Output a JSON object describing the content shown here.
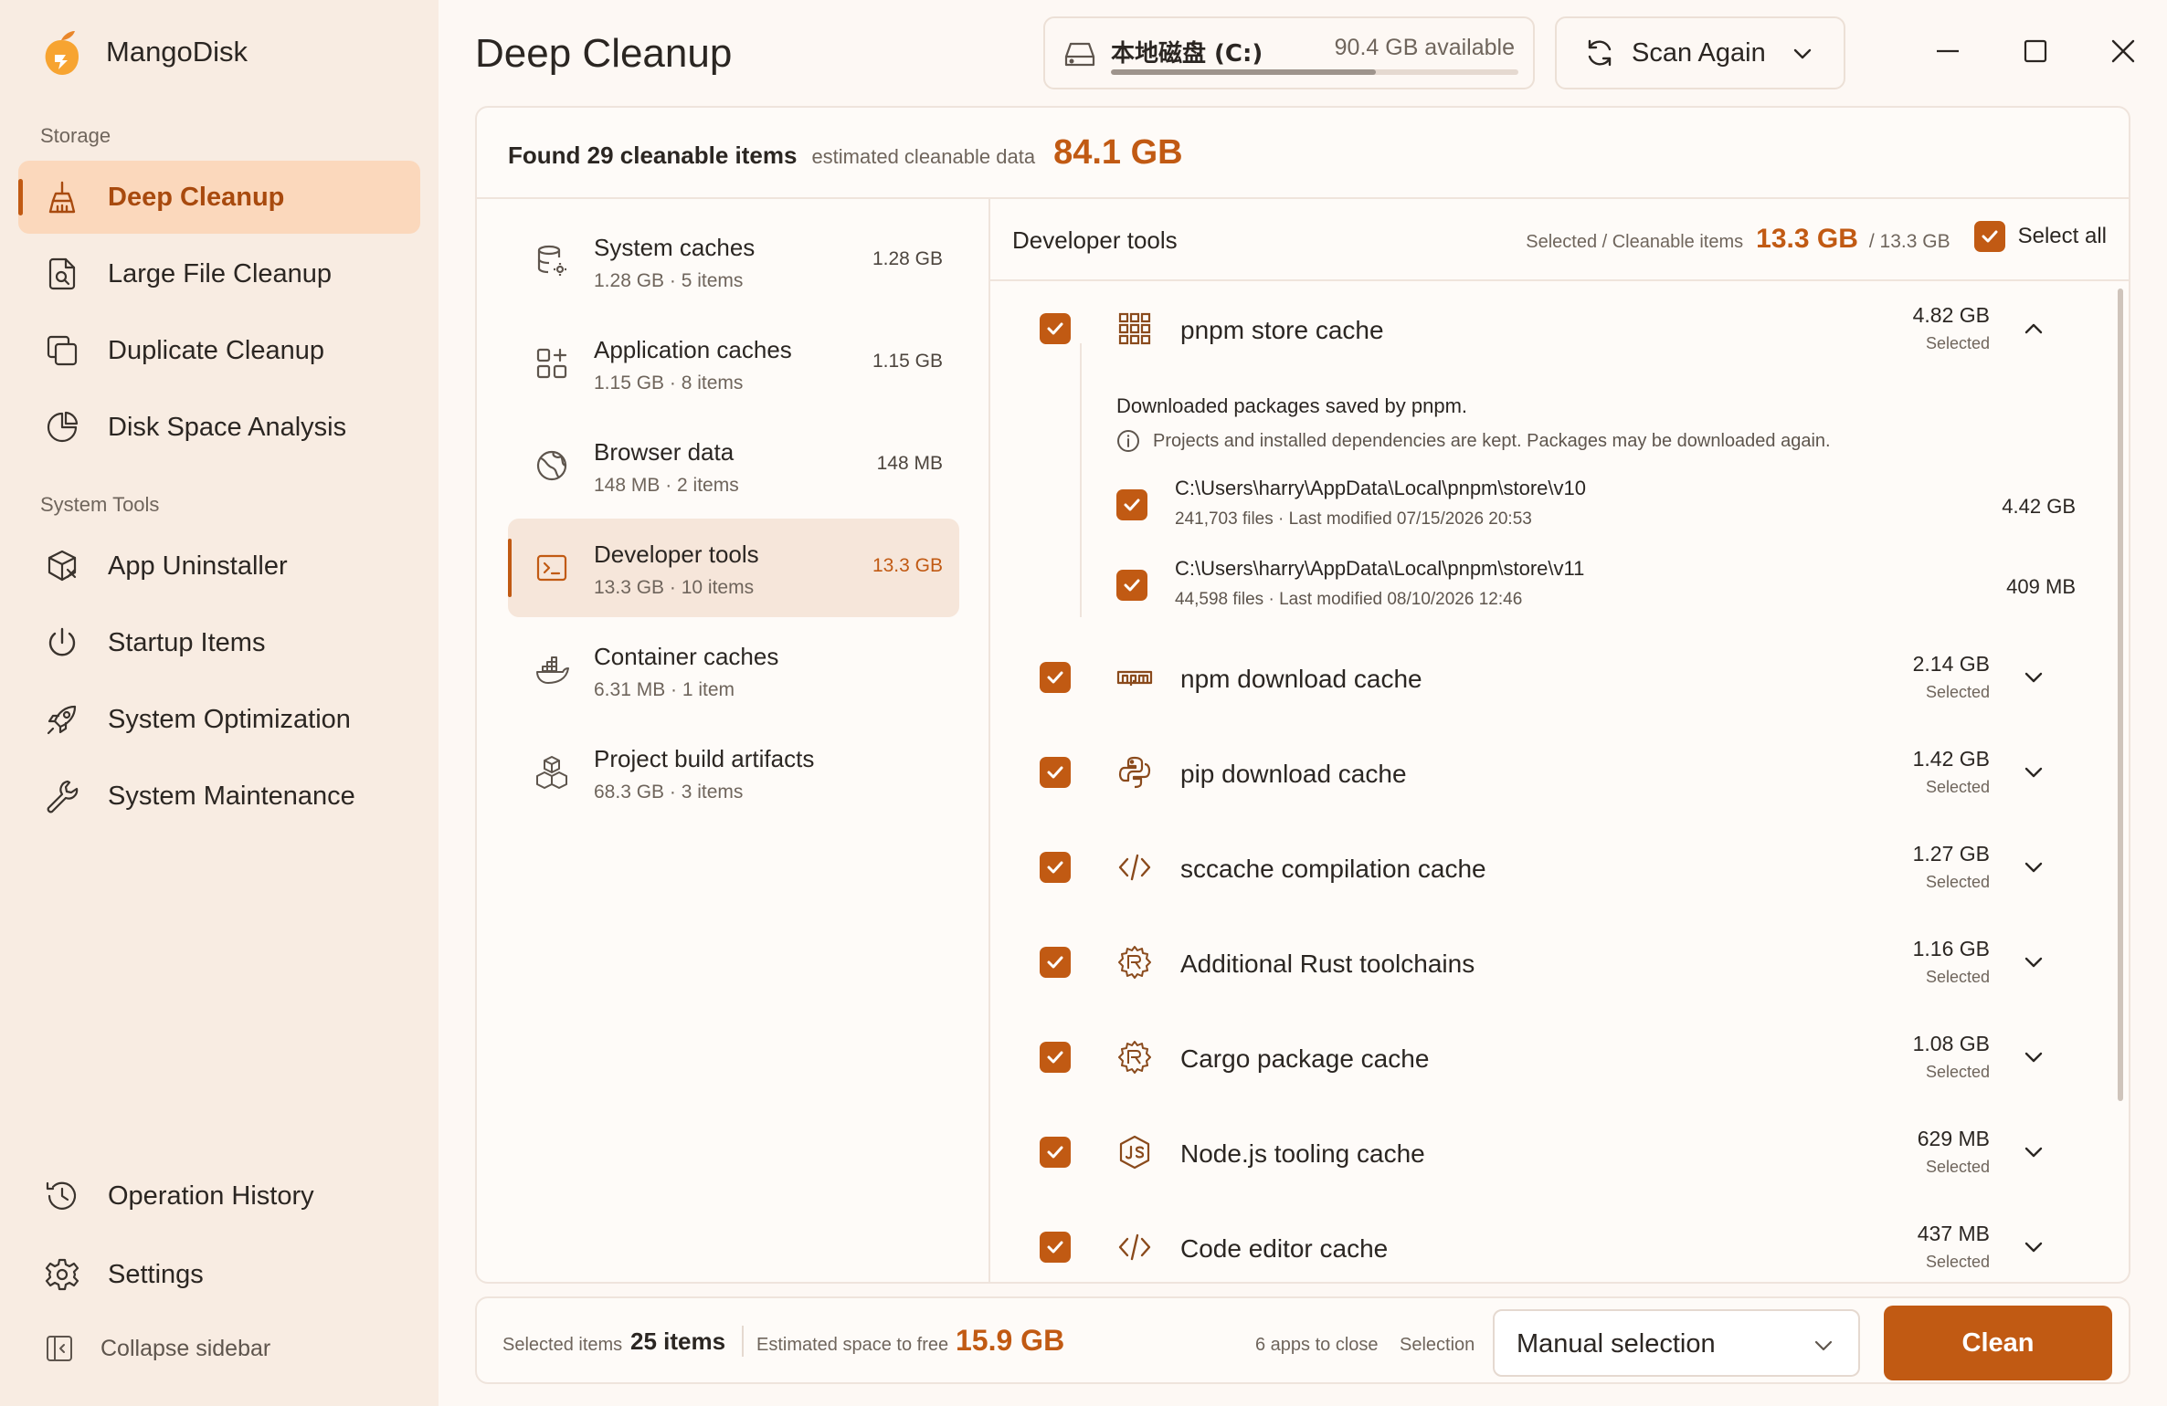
{
  "app": {
    "name": "MangoDisk"
  },
  "sidebar": {
    "sections": [
      {
        "label": "Storage"
      },
      {
        "label": "System Tools"
      }
    ],
    "items": [
      {
        "label": "Deep Cleanup",
        "icon": "broom-icon"
      },
      {
        "label": "Large File Cleanup",
        "icon": "file-search-icon"
      },
      {
        "label": "Duplicate Cleanup",
        "icon": "copy-icon"
      },
      {
        "label": "Disk Space Analysis",
        "icon": "pie-chart-icon"
      },
      {
        "label": "App Uninstaller",
        "icon": "package-x-icon"
      },
      {
        "label": "Startup Items",
        "icon": "power-icon"
      },
      {
        "label": "System Optimization",
        "icon": "rocket-icon"
      },
      {
        "label": "System Maintenance",
        "icon": "wrench-icon"
      },
      {
        "label": "Operation History",
        "icon": "history-icon"
      },
      {
        "label": "Settings",
        "icon": "gear-icon"
      }
    ],
    "collapse_label": "Collapse sidebar"
  },
  "header": {
    "title": "Deep Cleanup",
    "drive": {
      "name": "本地磁盘 (C:)",
      "available": "90.4 GB available",
      "used_fraction": 0.65
    },
    "scan_label": "Scan Again"
  },
  "summary": {
    "found": "Found 29 cleanable items",
    "estimated_label": "estimated cleanable data",
    "estimated_value": "84.1 GB"
  },
  "categories": [
    {
      "title": "System caches",
      "sub": "1.28 GB · 5 items",
      "size": "1.28 GB"
    },
    {
      "title": "Application caches",
      "sub": "1.15 GB · 8 items",
      "size": "1.15 GB"
    },
    {
      "title": "Browser data",
      "sub": "148 MB · 2 items",
      "size": "148 MB"
    },
    {
      "title": "Developer tools",
      "sub": "13.3 GB · 10 items",
      "size": "13.3 GB"
    },
    {
      "title": "Container caches",
      "sub": "6.31 MB · 1 item",
      "size": ""
    },
    {
      "title": "Project build artifacts",
      "sub": "68.3 GB · 3 items",
      "size": ""
    }
  ],
  "detail": {
    "title": "Developer tools",
    "selected_label": "Selected / Cleanable items",
    "selected_value": "13.3 GB",
    "total": "/ 13.3 GB",
    "select_all": "Select all",
    "items": [
      {
        "name": "pnpm store cache",
        "size": "4.82 GB",
        "status": "Selected"
      },
      {
        "name": "npm download cache",
        "size": "2.14 GB",
        "status": "Selected"
      },
      {
        "name": "pip download cache",
        "size": "1.42 GB",
        "status": "Selected"
      },
      {
        "name": "sccache compilation cache",
        "size": "1.27 GB",
        "status": "Selected"
      },
      {
        "name": "Additional Rust toolchains",
        "size": "1.16 GB",
        "status": "Selected"
      },
      {
        "name": "Cargo package cache",
        "size": "1.08 GB",
        "status": "Selected"
      },
      {
        "name": "Node.js tooling cache",
        "size": "629 MB",
        "status": "Selected"
      },
      {
        "name": "Code editor cache",
        "size": "437 MB",
        "status": "Selected"
      }
    ],
    "expanded": {
      "description": "Downloaded packages saved by pnpm.",
      "note": "Projects and installed dependencies are kept. Packages may be downloaded again.",
      "paths": [
        {
          "path": "C:\\Users\\harry\\AppData\\Local\\pnpm\\store\\v10",
          "meta": "241,703 files · Last modified 07/15/2026 20:53",
          "size": "4.42 GB"
        },
        {
          "path": "C:\\Users\\harry\\AppData\\Local\\pnpm\\store\\v11",
          "meta": "44,598 files · Last modified 08/10/2026 12:46",
          "size": "409 MB"
        }
      ]
    }
  },
  "footer": {
    "selected_label": "Selected items",
    "selected_value": "25 items",
    "free_label": "Estimated space to free",
    "free_value": "15.9 GB",
    "apps_to_close": "6 apps to close",
    "selection_label": "Selection",
    "selection_value": "Manual selection",
    "clean_label": "Clean"
  },
  "colors": {
    "accent": "#c15a13",
    "accent_bg": "#fbd8bc",
    "sidebar_bg": "#f8ece2"
  }
}
